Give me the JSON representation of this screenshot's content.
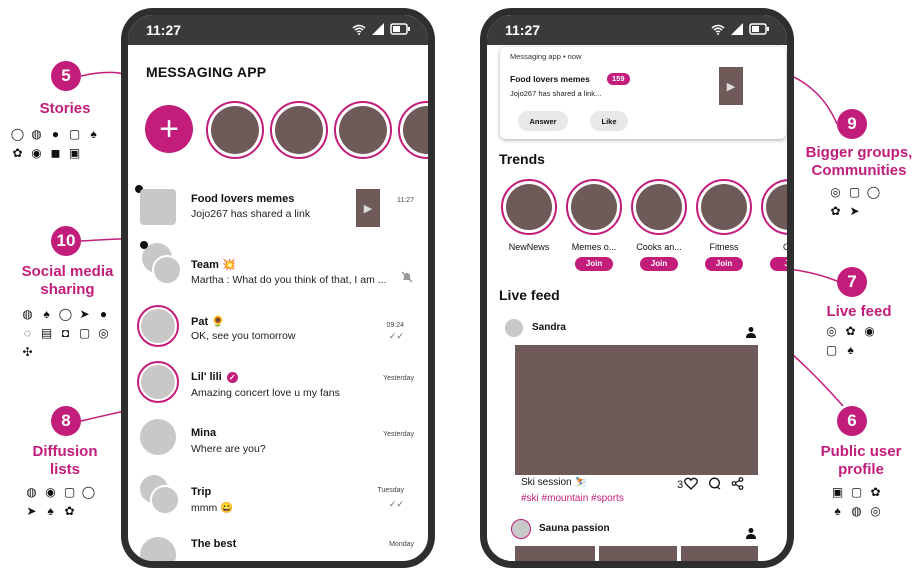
{
  "colors": {
    "accent": "#c21d7a",
    "placeholder": "#6e5a58",
    "avatar": "#c8c8c8"
  },
  "annotations": {
    "stories": {
      "number": "5",
      "label": "Stories",
      "icons": [
        "whatsapp-icon",
        "messenger-icon",
        "signal-icon",
        "instagram-icon",
        "snapchat-icon",
        "wechat-icon",
        "line-icon",
        "imessage-icon",
        "teams-icon"
      ]
    },
    "social": {
      "number": "10",
      "label_line1": "Social media",
      "label_line2": "sharing",
      "icons": [
        "messenger-icon",
        "snapchat-icon",
        "whatsapp-icon",
        "telegram-icon",
        "signal-icon",
        "imessage-icon",
        "sms-icon",
        "discord-icon",
        "instagram-icon",
        "viber-icon",
        "slack-icon"
      ]
    },
    "diffusion": {
      "number": "8",
      "label_line1": "Diffusion",
      "label_line2": "lists",
      "icons": [
        "messenger-icon",
        "line-icon",
        "instagram-icon",
        "whatsapp-icon",
        "telegram-icon",
        "snapchat-icon",
        "wechat-icon"
      ]
    },
    "groups": {
      "number": "9",
      "label_line1": "Bigger groups,",
      "label_line2": "Communities",
      "icons": [
        "viber-icon",
        "instagram-icon",
        "whatsapp-icon",
        "wechat-icon",
        "telegram-icon"
      ]
    },
    "livefeed": {
      "number": "7",
      "label": "Live feed",
      "icons": [
        "viber-icon",
        "wechat-icon",
        "line-icon",
        "instagram-icon",
        "snapchat-icon"
      ]
    },
    "profile": {
      "number": "6",
      "label_line1": "Public user",
      "label_line2": "profile",
      "icons": [
        "teams-icon",
        "instagram-icon",
        "wechat-icon",
        "snapchat-icon",
        "messenger-icon",
        "viber-icon"
      ]
    }
  },
  "phone1": {
    "time": "11:27",
    "title": "MESSAGING APP",
    "add_story": "+",
    "chats": [
      {
        "name": "Food lovers memes",
        "message": "Jojo267 has shared a link",
        "time": "11:27"
      },
      {
        "name": "Team 💥",
        "message": "Martha : What do you think of that, I am ...",
        "time": ""
      },
      {
        "name": "Pat 🌻",
        "message": "OK, see you tomorrow",
        "time": "09:24"
      },
      {
        "name": "Lil' lili",
        "message": "Amazing concert love u my fans",
        "time": "Yesterday"
      },
      {
        "name": "Mina",
        "message": "Where are you?",
        "time": "Yesterday"
      },
      {
        "name": "Trip",
        "message": "mmm 😀",
        "time": "Tuesday"
      },
      {
        "name": "The best",
        "message": "",
        "time": "Monday"
      }
    ]
  },
  "phone2": {
    "time": "11:27",
    "notification": {
      "header": "Messaging app • now",
      "title": "Food lovers memes",
      "count": "159",
      "message": "Jojo267 has shared a link...",
      "answer": "Answer",
      "like": "Like"
    },
    "trends_title": "Trends",
    "trends": [
      {
        "name": "NewNews",
        "join": ""
      },
      {
        "name": "Memes o...",
        "join": "Join"
      },
      {
        "name": "Cooks an...",
        "join": "Join"
      },
      {
        "name": "Fitness",
        "join": "Join"
      },
      {
        "name": "Ou",
        "join": "Jo"
      }
    ],
    "live_feed_title": "Live feed",
    "posts": [
      {
        "author": "Sandra",
        "caption": "Ski session ⛷️",
        "tags": "#ski #mountain #sports",
        "likes": "3"
      },
      {
        "author": "Sauna passion"
      }
    ]
  }
}
